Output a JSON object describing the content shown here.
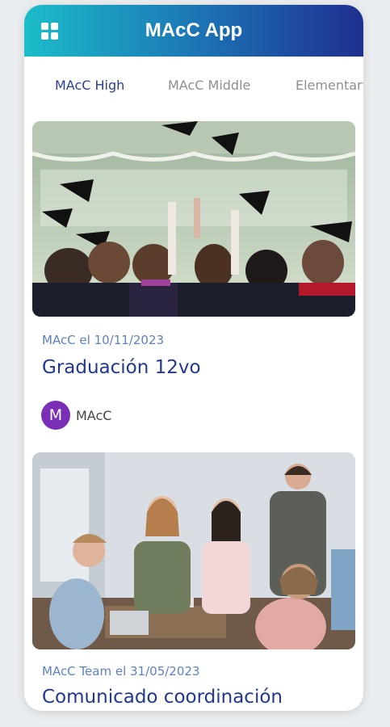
{
  "app": {
    "title": "MAcC App"
  },
  "tabs": [
    {
      "label": "MAcC High"
    },
    {
      "label": "MAcC Middle"
    },
    {
      "label": "Elementary"
    }
  ],
  "posts": [
    {
      "meta": "MAcC el 10/11/2023",
      "title": "Graduación 12vo",
      "author": "MAcC",
      "avatar_letter": "M"
    },
    {
      "meta": "MAcC Team el 31/05/2023",
      "title": "Comunicado coordinación"
    }
  ],
  "colors": {
    "accent": "#22388d",
    "meta": "#5e80c4",
    "avatar": "#7b2fb6"
  }
}
